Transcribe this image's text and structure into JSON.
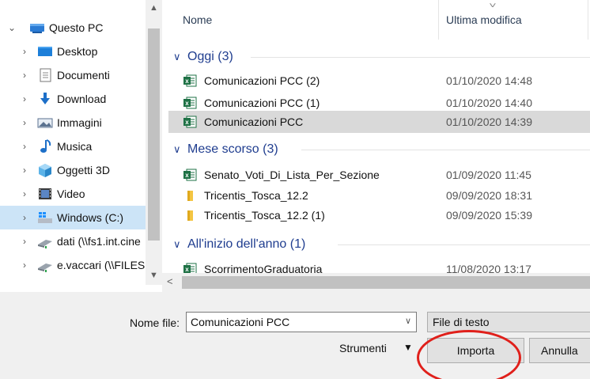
{
  "nav": {
    "items": [
      {
        "label": "Questo PC",
        "icon": "this-pc-icon",
        "chevron": "⌄"
      },
      {
        "label": "Desktop",
        "icon": "desktop-folder-icon",
        "chevron": "›"
      },
      {
        "label": "Documenti",
        "icon": "documents-folder-icon",
        "chevron": "›"
      },
      {
        "label": "Download",
        "icon": "download-folder-icon",
        "chevron": "›"
      },
      {
        "label": "Immagini",
        "icon": "pictures-folder-icon",
        "chevron": "›"
      },
      {
        "label": "Musica",
        "icon": "music-folder-icon",
        "chevron": "›"
      },
      {
        "label": "Oggetti 3D",
        "icon": "3d-objects-folder-icon",
        "chevron": "›"
      },
      {
        "label": "Video",
        "icon": "video-folder-icon",
        "chevron": "›"
      },
      {
        "label": "Windows (C:)",
        "icon": "windows-drive-icon",
        "chevron": "›"
      },
      {
        "label": "dati (\\\\fs1.int.cine",
        "icon": "network-drive-icon",
        "chevron": "›"
      },
      {
        "label": "e.vaccari (\\\\FILES",
        "icon": "network-drive-icon",
        "chevron": "›"
      }
    ]
  },
  "columns": {
    "name": "Nome",
    "modified": "Ultima modifica"
  },
  "groups": [
    {
      "label": "Oggi (3)",
      "files": [
        {
          "name": "Comunicazioni PCC (2)",
          "date": "01/10/2020 14:48",
          "icon": "excel-file-icon"
        },
        {
          "name": "Comunicazioni PCC (1)",
          "date": "01/10/2020 14:40",
          "icon": "excel-file-icon"
        },
        {
          "name": "Comunicazioni PCC",
          "date": "01/10/2020 14:39",
          "icon": "excel-file-icon"
        }
      ]
    },
    {
      "label": "Mese scorso (3)",
      "files": [
        {
          "name": "Senato_Voti_Di_Lista_Per_Sezione",
          "date": "01/09/2020 11:45",
          "icon": "excel-file-icon"
        },
        {
          "name": "Tricentis_Tosca_12.2",
          "date": "09/09/2020 18:31",
          "icon": "folder-icon"
        },
        {
          "name": "Tricentis_Tosca_12.2 (1)",
          "date": "09/09/2020 15:39",
          "icon": "folder-icon"
        }
      ]
    },
    {
      "label": "All'inizio dell'anno (1)",
      "files": [
        {
          "name": "ScorrimentoGraduatoria",
          "date": "11/08/2020 13:17",
          "icon": "excel-file-icon"
        }
      ]
    }
  ],
  "bottom": {
    "filename_label": "Nome file:",
    "filename_value": "Comunicazioni PCC",
    "filetype_value": "File di testo",
    "tools_label": "Strumenti",
    "import_label": "Importa",
    "cancel_label": "Annulla"
  },
  "colors": {
    "accent": "#1f3d8f",
    "selection": "#cce4f7",
    "highlight_circle": "#e0201b",
    "excel_green": "#1e7145"
  }
}
